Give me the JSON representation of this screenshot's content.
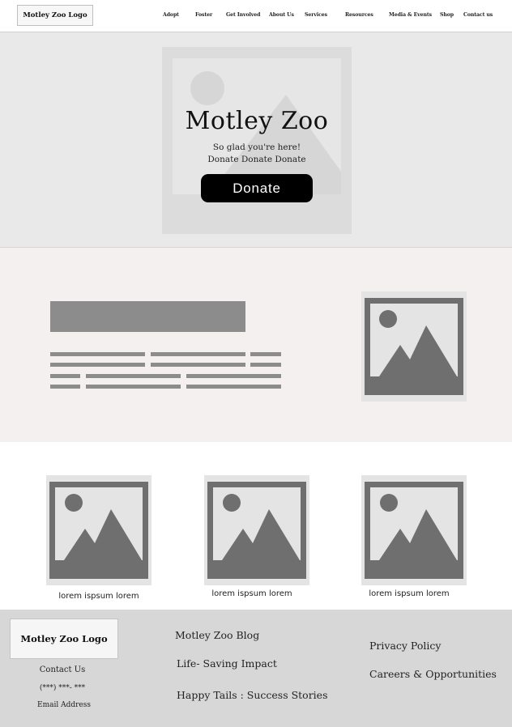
{
  "header": {
    "logo": "Motley Zoo Logo",
    "nav": [
      "Adopt",
      "Foster",
      "Get Involved",
      "About Us",
      "Services",
      "Resources",
      "Media & Events",
      "Shop",
      "Contact us"
    ]
  },
  "hero": {
    "title": "Motley Zoo",
    "subtitle_line1": "So glad you're here!",
    "subtitle_line2": "Donate Donate Donate",
    "button": "Donate"
  },
  "cards": [
    {
      "caption": "lorem ispsum lorem"
    },
    {
      "caption": "lorem ispsum lorem"
    },
    {
      "caption": "lorem ispsum lorem"
    }
  ],
  "footer": {
    "logo": "Motley Zoo Logo",
    "contact_heading": "Contact Us",
    "phone": "(***) ***- ***",
    "email": "Email Address",
    "links_col1": [
      "Motley Zoo Blog",
      "Life- Saving Impact",
      "Happy Tails : Success Stories"
    ],
    "links_col2": [
      "Privacy Policy",
      "Careers & Opportunities"
    ]
  },
  "colors": {
    "placeholder_dark": "#6f6f6f",
    "placeholder_light": "#e4e4e4",
    "section_bg": "#f4f0ef",
    "footer_bg": "#d7d7d7",
    "button_bg": "#000000"
  }
}
